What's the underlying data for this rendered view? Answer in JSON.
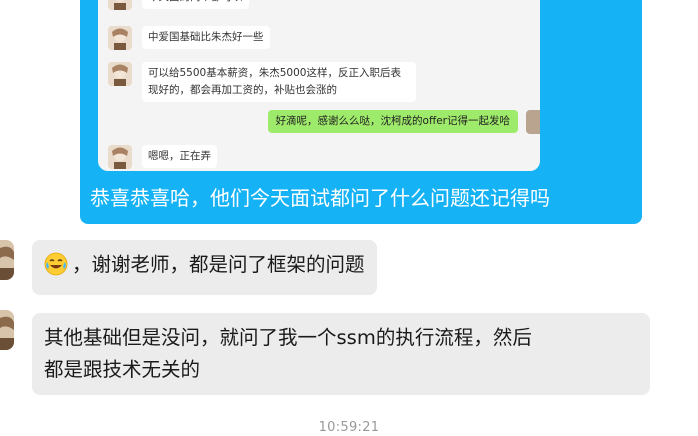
{
  "shared_screenshot": {
    "messages": [
      {
        "type": "received",
        "text": "今天面的两个都可以",
        "clipped": true
      },
      {
        "type": "received",
        "text": "中爱国基础比朱杰好一些"
      },
      {
        "type": "received",
        "text": "可以给5500基本薪资，朱杰5000这样，反正入职后表\n现好的，都会再加工资的，补贴也会涨的"
      },
      {
        "type": "sent",
        "text": "好滴呢，感谢么么哒，沈柯成的offer记得一起发哈"
      },
      {
        "type": "received",
        "text": "嗯嗯，正在弄"
      }
    ],
    "caption": "恭喜恭喜哈，他们今天面试都问了什么问题还记得吗"
  },
  "messages": [
    {
      "emoji": "tears-of-joy-emoji",
      "text": "，谢谢老师，都是问了框架的问题"
    },
    {
      "line1": "其他基础但是没问，就问了我一个ssm的执行流程，然后",
      "line2": "都是跟技术无关的"
    }
  ],
  "timestamp": "10:59:21",
  "colors": {
    "outer_bubble": "#16b2f6",
    "received_bubble": "#ececec",
    "sent_bubble": "#9eea6a",
    "timestamp": "#999999"
  }
}
